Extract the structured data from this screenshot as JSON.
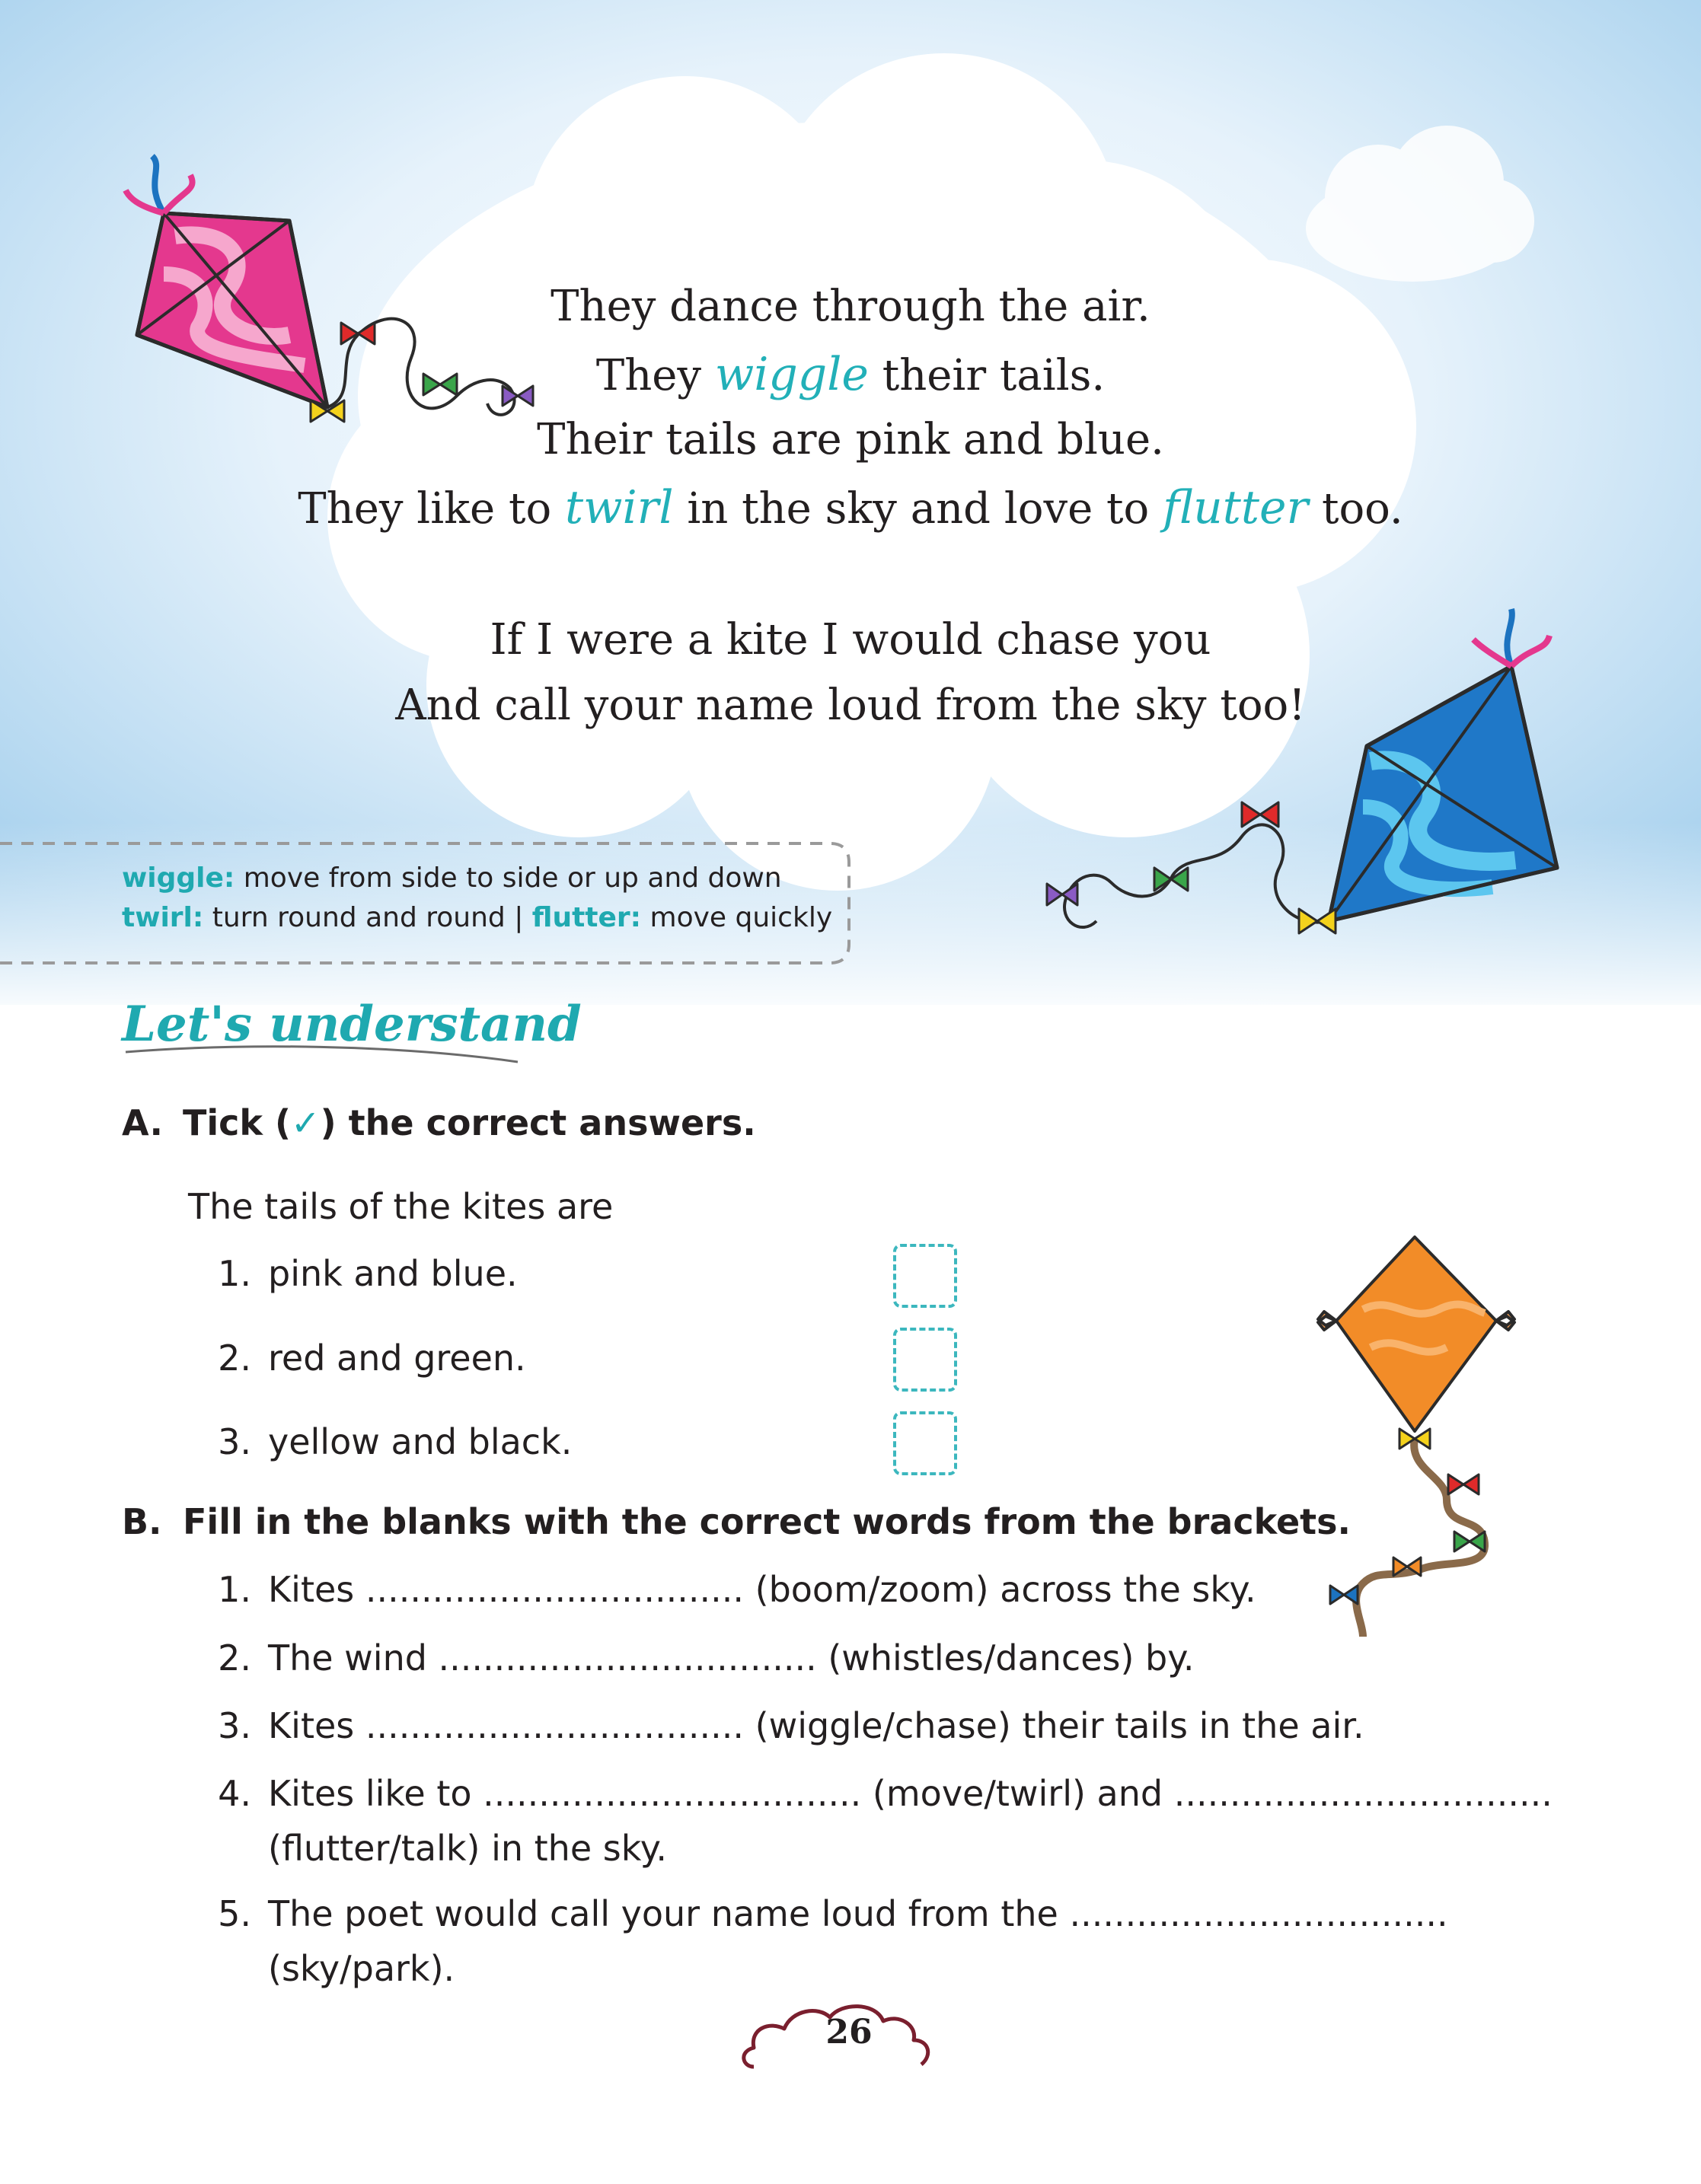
{
  "poem": {
    "line1": "They dance through the air.",
    "line2_a": "They ",
    "line2_word": "wiggle",
    "line2_b": " their tails.",
    "line3": "Their tails are pink and blue.",
    "line4_a": "They like to ",
    "line4_word1": "twirl",
    "line4_b": " in the sky and love to ",
    "line4_word2": "flutter",
    "line4_c": " too.",
    "line5": "If I were a kite I would chase you",
    "line6": "And call your name loud from the sky too!"
  },
  "glossary": {
    "wiggle_term": "wiggle:",
    "wiggle_def": " move from side to side or up and down",
    "twirl_term": "twirl:",
    "twirl_def": " turn round and round | ",
    "flutter_term": "flutter:",
    "flutter_def": " move quickly"
  },
  "section_heading": "Let's understand",
  "question_a": {
    "letter": "A.",
    "text_before": "Tick (",
    "tick_symbol": "✓",
    "text_after": ") the correct answers.",
    "stem": "The tails of the kites are",
    "options": [
      {
        "num": "1.",
        "text": "pink and blue."
      },
      {
        "num": "2.",
        "text": "red and green."
      },
      {
        "num": "3.",
        "text": "yellow and black."
      }
    ]
  },
  "question_b": {
    "letter": "B.",
    "title": "Fill in the blanks with the correct words from the brackets.",
    "items": [
      {
        "num": "1.",
        "line1": "Kites .................................. (boom/zoom) across the sky."
      },
      {
        "num": "2.",
        "line1": "The wind .................................. (whistles/dances) by."
      },
      {
        "num": "3.",
        "line1": "Kites .................................. (wiggle/chase) their tails in the air."
      },
      {
        "num": "4.",
        "line1": "Kites like to .................................. (move/twirl) and ..................................",
        "line2": "(flutter/talk) in the sky."
      },
      {
        "num": "5.",
        "line1": "The poet would call your name loud from the ..................................",
        "line2": "(sky/park)."
      }
    ]
  },
  "page_number": "26",
  "colors": {
    "accent_teal": "#1fa9b0",
    "sky_blue": "#b9dcf2",
    "pink_kite": "#e4388e",
    "blue_kite": "#1f78c8",
    "orange_kite": "#f28c28",
    "page_cloud_outline": "#7a1f2e"
  }
}
